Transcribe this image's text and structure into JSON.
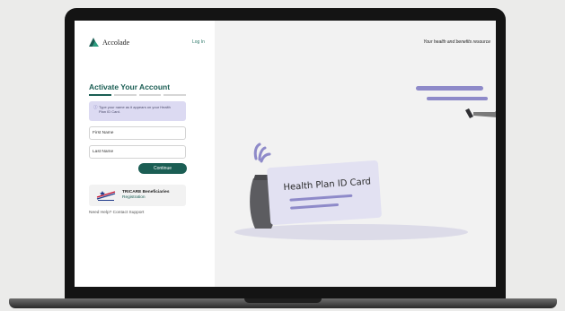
{
  "brand": {
    "name": "Accolade",
    "accent": "#1b5e54",
    "illustration_accent": "#8e8ac9"
  },
  "header": {
    "login_label": "Log In",
    "tagline": "Your health and benefits resource"
  },
  "form": {
    "title": "Activate Your Account",
    "steps_total": 4,
    "steps_completed": 1,
    "hint": "Type your name as it appears on your Health Plan ID Card.",
    "first_name_placeholder": "First Name",
    "last_name_placeholder": "Last Name",
    "continue_label": "Continue"
  },
  "tricare": {
    "title": "TRICARE Beneficiaries",
    "subtitle": "Registration"
  },
  "help": {
    "text": "Need Help? Contact Support"
  },
  "illustration": {
    "card_text": "Health Plan ID Card"
  }
}
